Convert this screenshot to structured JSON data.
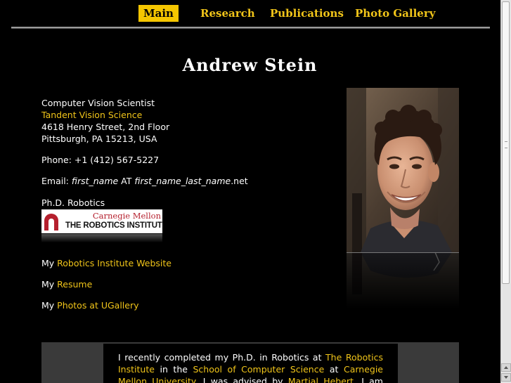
{
  "nav": {
    "items": [
      {
        "label": "Main",
        "active": true
      },
      {
        "label": "Research",
        "active": false
      },
      {
        "label": "Publications",
        "active": false
      },
      {
        "label": "Photo Gallery",
        "active": false
      }
    ]
  },
  "page": {
    "title": "Andrew Stein"
  },
  "contact": {
    "role": "Computer Vision Scientist",
    "company": "Tandent Vision Science",
    "street": "4618 Henry Street, 2nd Floor",
    "city": "Pittsburgh, PA 15213, USA",
    "phone": "Phone: +1 (412) 567-5227",
    "email_prefix": "Email: ",
    "email_user": "first_name",
    "email_at": " AT ",
    "email_domain": "first_name_last_name",
    "email_tld": ".net",
    "degree": "Ph.D. Robotics"
  },
  "logo": {
    "top_text": "Carnegie Mellon",
    "main_text": "THE ROBOTICS INSTITUTE"
  },
  "links": [
    {
      "prefix": "My ",
      "label": "Robotics Institute Website"
    },
    {
      "prefix": "My ",
      "label": "Resume"
    },
    {
      "prefix": "My ",
      "label": "Photos at UGallery"
    }
  ],
  "bio": {
    "t1": "I recently completed my Ph.D. in Robotics at ",
    "l1": "The Robotics Institute",
    "t2": " in the ",
    "l2": "School of Computer Science",
    "t3": " at ",
    "l3": "Carnegie Mellon University",
    "t4": ". I was advised by ",
    "l4": "Martial Hebert",
    "t5": ". I am now a Computer"
  },
  "colors": {
    "link": "#f0c419",
    "nav_active_bg": "#f5c600",
    "background": "#000000"
  },
  "icons": {
    "portrait": "portrait-photo",
    "logo": "robotics-institute-logo"
  }
}
